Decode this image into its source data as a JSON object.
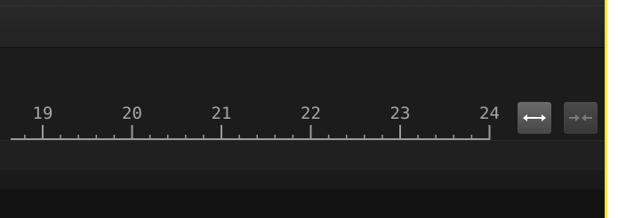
{
  "timeline": {
    "hour_labels": [
      "19",
      "20",
      "21",
      "22",
      "23",
      "24"
    ],
    "minor_ticks_per_hour": 5
  },
  "controls": {
    "expand_icon": "expand-horizontal-icon",
    "collapse_icon": "collapse-horizontal-icon"
  },
  "colors": {
    "panel_background": "#1e1e1e",
    "ruler": "#9a9a9a",
    "label": "#a6a6a6",
    "accent_edge": "#f2e82a"
  }
}
